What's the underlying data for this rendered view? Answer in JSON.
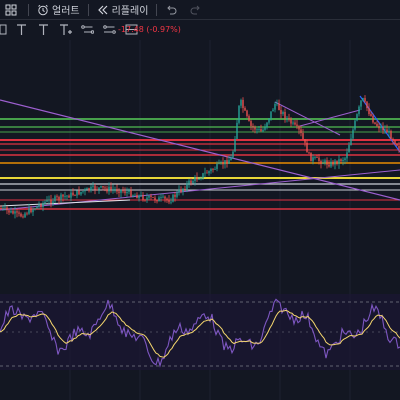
{
  "toolbar": {
    "layout_icon": "grid-icon",
    "alert_label": "얼러트",
    "alert_icon": "alarm-clock-icon",
    "replay_label": "리플레이",
    "replay_icon": "rewind-icon",
    "undo_icon": "undo-icon",
    "redo_icon": "redo-icon"
  },
  "drawing_tools": [
    {
      "name": "trend-line-tool",
      "icon": "trend-line-icon"
    },
    {
      "name": "text-tool",
      "icon": "text-icon",
      "glyph": "T"
    },
    {
      "name": "text-t-tool",
      "icon": "text-icon",
      "glyph": "T"
    },
    {
      "name": "text-t-plus-tool",
      "icon": "text-plus-icon",
      "glyph": "T"
    },
    {
      "name": "arrow-marker-tool",
      "icon": "arrow-marker-icon"
    },
    {
      "name": "price-range-tool",
      "icon": "price-range-icon"
    },
    {
      "name": "long-position-tool",
      "icon": "long-position-icon"
    }
  ],
  "price_change": "-17.48 (-0.97%)",
  "colors": {
    "background": "#131722",
    "candle_up": "#26a69a",
    "candle_down": "#ef5350",
    "line_green": "#4caf50",
    "line_red": "#f23645",
    "line_orange": "#ff9800",
    "line_yellow": "#ffeb3b",
    "line_white": "#e0e3eb",
    "trend_purple": "#9c5fcf",
    "trend_blue": "#2962ff",
    "oscillator": "#7e57c2",
    "signal": "#f5d76e"
  }
}
